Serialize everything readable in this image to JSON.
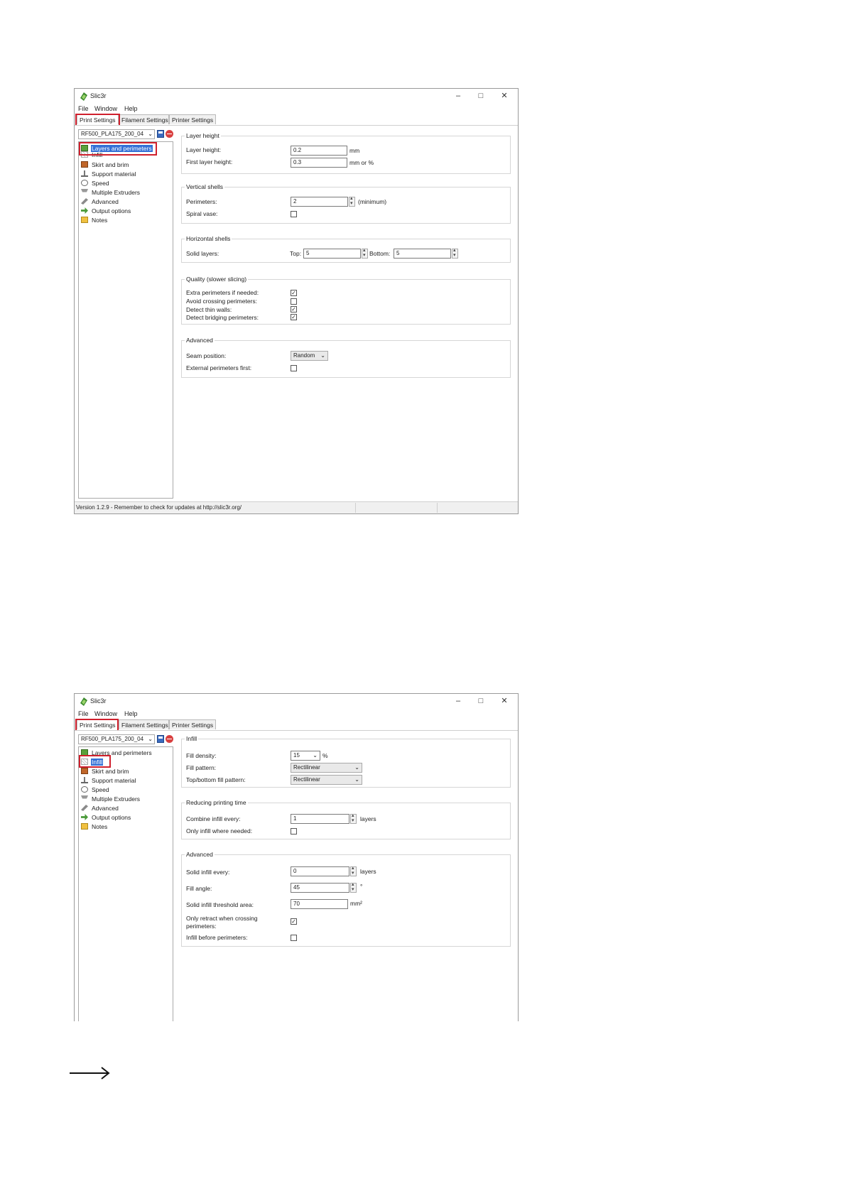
{
  "app": {
    "title": "Slic3r"
  },
  "menu": [
    "File",
    "Window",
    "Help"
  ],
  "tabs": [
    "Print Settings",
    "Filament Settings",
    "Printer Settings"
  ],
  "preset": "RF500_PLA175_200_04",
  "tree": [
    "Layers and perimeters",
    "Infill",
    "Skirt and brim",
    "Support material",
    "Speed",
    "Multiple Extruders",
    "Advanced",
    "Output options",
    "Notes"
  ],
  "icons": [
    "slic3r-logo-icon",
    "minimize-icon",
    "maximize-icon",
    "close-icon",
    "save-preset-icon",
    "delete-preset-icon",
    "chevron-down-icon",
    "arrow-right-icon"
  ],
  "colors": {
    "highlight": "#d0202d",
    "selection": "#3370d6"
  },
  "screen1": {
    "layer_height": {
      "title": "Layer height",
      "layer_height_label": "Layer height:",
      "layer_height_value": "0.2",
      "layer_height_unit": "mm",
      "first_layer_label": "First layer height:",
      "first_layer_value": "0.3",
      "first_layer_unit": "mm or %"
    },
    "vertical_shells": {
      "title": "Vertical shells",
      "perimeters_label": "Perimeters:",
      "perimeters_value": "2",
      "perimeters_unit": "(minimum)",
      "spiral_label": "Spiral vase:",
      "spiral_checked": false
    },
    "horizontal_shells": {
      "title": "Horizontal shells",
      "solid_layers_label": "Solid layers:",
      "top_label": "Top:",
      "top_value": "5",
      "bottom_label": "Bottom:",
      "bottom_value": "5"
    },
    "quality": {
      "title": "Quality (slower slicing)",
      "items": [
        {
          "label": "Extra perimeters if needed:",
          "checked": true
        },
        {
          "label": "Avoid crossing perimeters:",
          "checked": false
        },
        {
          "label": "Detect thin walls:",
          "checked": true
        },
        {
          "label": "Detect bridging perimeters:",
          "checked": true
        }
      ]
    },
    "advanced": {
      "title": "Advanced",
      "seam_label": "Seam position:",
      "seam_value": "Random",
      "external_first_label": "External perimeters first:",
      "external_first_checked": false
    },
    "status": "Version 1.2.9 - Remember to check for updates at http://slic3r.org/"
  },
  "screen2": {
    "infill": {
      "title": "Infill",
      "density_label": "Fill density:",
      "density_value": "15",
      "density_unit": "%",
      "pattern_label": "Fill pattern:",
      "pattern_value": "Rectilinear",
      "tb_pattern_label": "Top/bottom fill pattern:",
      "tb_pattern_value": "Rectilinear"
    },
    "reducing": {
      "title": "Reducing printing time",
      "combine_label": "Combine infill every:",
      "combine_value": "1",
      "combine_unit": "layers",
      "only_needed_label": "Only infill where needed:",
      "only_needed_checked": false
    },
    "advanced": {
      "title": "Advanced",
      "solid_every_label": "Solid infill every:",
      "solid_every_value": "0",
      "solid_every_unit": "layers",
      "angle_label": "Fill angle:",
      "angle_value": "45",
      "angle_unit": "°",
      "threshold_label": "Solid infill threshold area:",
      "threshold_value": "70",
      "threshold_unit": "mm²",
      "retract_label_1": "Only retract when crossing",
      "retract_label_2": "perimeters:",
      "retract_checked": true,
      "before_label": "Infill before perimeters:",
      "before_checked": false
    }
  }
}
